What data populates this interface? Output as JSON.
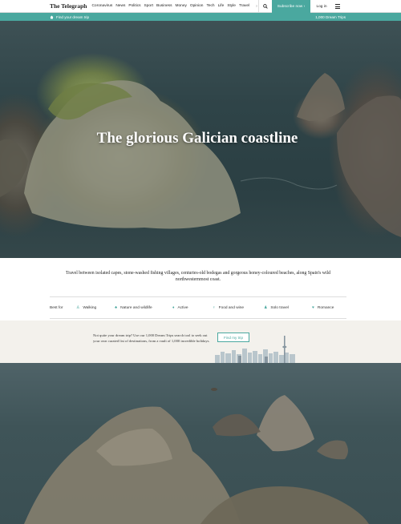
{
  "nav": {
    "logo": "The Telegraph",
    "links": [
      "Coronavirus",
      "News",
      "Politics",
      "Sport",
      "Business",
      "Money",
      "Opinion",
      "Tech",
      "Life",
      "Style",
      "Travel"
    ],
    "more": "›",
    "subscribe": "Subscribe now ›",
    "login": "Log in"
  },
  "subnav": {
    "home": "Find your dream trip",
    "right": "1,000 Dream Trips"
  },
  "hero": {
    "title": "The glorious Galician coastline"
  },
  "intro": "Travel between isolated capes, stone-washed fishing villages, centuries-old bodegas and gorgeous honey-coloured beaches, along Spain's wild northwesternmost coast.",
  "best_for": {
    "label": "Best for",
    "items": [
      {
        "icon": "walking-icon",
        "label": "Walking"
      },
      {
        "icon": "nature-icon",
        "label": "Nature and wildlife"
      },
      {
        "icon": "active-icon",
        "label": "Active"
      },
      {
        "icon": "food-wine-icon",
        "label": "Food and wine"
      },
      {
        "icon": "solo-icon",
        "label": "Solo travel"
      },
      {
        "icon": "romance-icon",
        "label": "Romance"
      }
    ]
  },
  "promo": {
    "text": "Not quite your dream trip? Use our 1,000 Dream Trips search tool to seek out your own curated list of destinations, from a vault of 1,000 incredible holidays.",
    "button": "Find my trip"
  },
  "colors": {
    "accent": "#4aa89f",
    "promo_bg": "#f3f1ec"
  }
}
